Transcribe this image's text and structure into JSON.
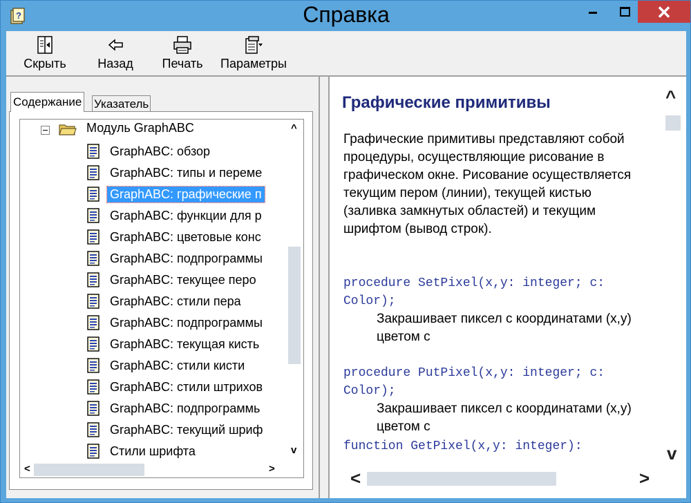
{
  "window": {
    "title": "Справка"
  },
  "toolbar": {
    "buttons": [
      {
        "label": "Скрыть",
        "icon": "hide-icon"
      },
      {
        "label": "Назад",
        "icon": "back-arrow-icon"
      },
      {
        "label": "Печать",
        "icon": "printer-icon"
      },
      {
        "label": "Параметры",
        "icon": "options-icon"
      }
    ]
  },
  "tabs": {
    "contents": "Содержание",
    "index": "Указатель"
  },
  "tree": {
    "root": "Модуль GraphABC",
    "items": [
      "GraphABC: обзор",
      "GraphABC: типы и переме",
      "GraphABC: графические п",
      "GraphABC: функции для р",
      "GraphABC: цветовые конс",
      "GraphABC: подпрограммы",
      "GraphABC: текущее перо",
      "GraphABC: стили пера",
      "GraphABC: подпрограммы",
      "GraphABC: текущая кисть",
      "GraphABC: стили кисти",
      "GraphABC: стили штрихов",
      "GraphABC: подпрограммь",
      "GraphABC: текущий шриф",
      "Стили шрифта"
    ],
    "selected_index": 2
  },
  "content": {
    "heading": "Графические примитивы",
    "intro": "Графические примитивы представляют собой процедуры, осуществляющие рисование в графическом окне. Рисование осуществляется текущим пером (линии), текущей кистью (заливка замкнутых областей) и текущим шрифтом (вывод строк).",
    "entries": [
      {
        "code": "procedure SetPixel(x,y: integer; c: Color);",
        "desc": "Закрашивает пиксел с координатами (x,y) цветом c"
      },
      {
        "code": "procedure PutPixel(x,y: integer; c: Color);",
        "desc": "Закрашивает пиксел с координатами (x,y) цветом c"
      },
      {
        "code": "function GetPixel(x,y: integer):",
        "desc": ""
      }
    ]
  },
  "colors": {
    "frame": "#5ba6dc",
    "close_button": "#c43e3e",
    "heading": "#1f2a7a",
    "code": "#2b3a9a",
    "selection": "#3399ff"
  }
}
